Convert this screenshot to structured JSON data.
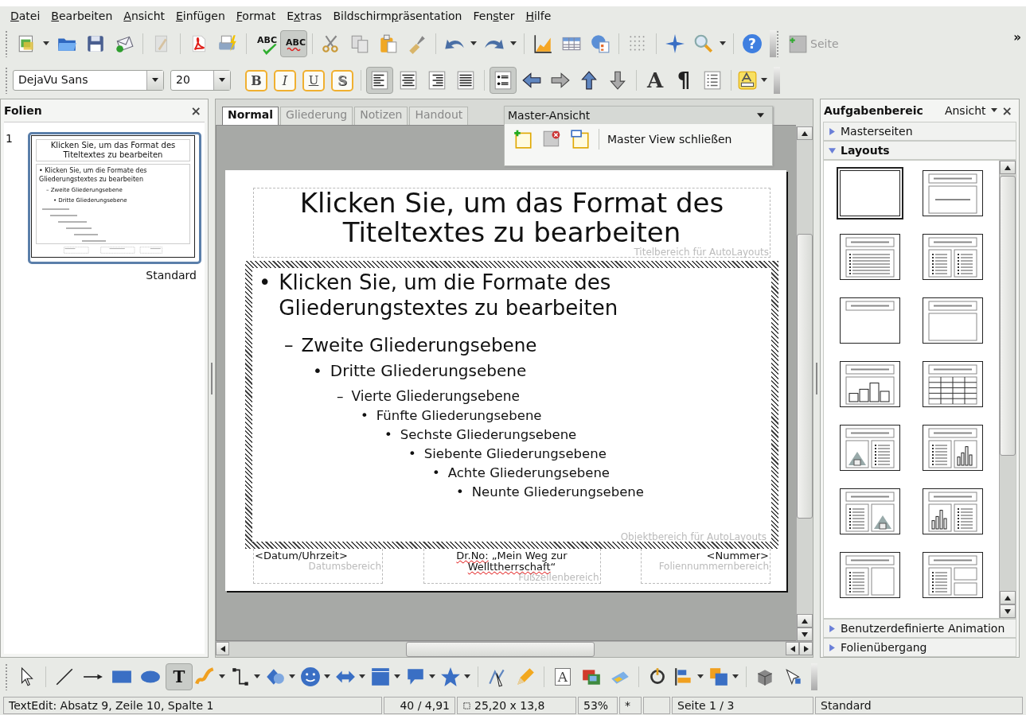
{
  "menu": [
    {
      "key": "D",
      "post": "atei"
    },
    {
      "key": "B",
      "post": "earbeiten"
    },
    {
      "key": "A",
      "post": "nsicht"
    },
    {
      "key": "E",
      "post": "infügen"
    },
    {
      "key": "F",
      "post": "ormat"
    },
    {
      "pre": "E",
      "key": "x",
      "post": "tras"
    },
    {
      "pre": "Bildschirm",
      "key": "p",
      "post": "räsentation"
    },
    {
      "pre": "Fen",
      "key": "s",
      "post": "ter"
    },
    {
      "key": "H",
      "post": "ilfe"
    }
  ],
  "standard_toolbar": {
    "items": [
      {
        "kind": "new",
        "pressed": false,
        "dropdown": true,
        "disabled": false
      },
      {
        "kind": "open",
        "pressed": false,
        "dropdown": false,
        "disabled": false
      },
      {
        "kind": "save",
        "pressed": false,
        "dropdown": false,
        "disabled": false
      },
      {
        "kind": "mail",
        "pressed": false,
        "dropdown": false,
        "disabled": false
      },
      {
        "kind": "separator"
      },
      {
        "kind": "edit",
        "pressed": false,
        "dropdown": false,
        "disabled": true
      },
      {
        "kind": "separator"
      },
      {
        "kind": "pdf",
        "pressed": false,
        "dropdown": false,
        "disabled": false
      },
      {
        "kind": "print",
        "pressed": false,
        "dropdown": false,
        "disabled": false
      },
      {
        "kind": "separator"
      },
      {
        "kind": "spellcheck",
        "label": "ABC",
        "pressed": false,
        "dropdown": false,
        "disabled": false
      },
      {
        "kind": "autospell",
        "label": "ABC",
        "pressed": true,
        "dropdown": false,
        "disabled": false
      },
      {
        "kind": "separator"
      },
      {
        "kind": "cut",
        "pressed": false,
        "dropdown": false,
        "disabled": false
      },
      {
        "kind": "copy",
        "pressed": false,
        "dropdown": false,
        "disabled": false
      },
      {
        "kind": "paste",
        "pressed": false,
        "dropdown": false,
        "disabled": false
      },
      {
        "kind": "brush",
        "pressed": false,
        "dropdown": false,
        "disabled": false
      },
      {
        "kind": "separator"
      },
      {
        "kind": "undo",
        "pressed": false,
        "dropdown": true,
        "disabled": false
      },
      {
        "kind": "redo",
        "pressed": false,
        "dropdown": true,
        "disabled": false
      },
      {
        "kind": "separator"
      },
      {
        "kind": "chart",
        "pressed": false,
        "dropdown": false,
        "disabled": false
      },
      {
        "kind": "table",
        "pressed": false,
        "dropdown": false,
        "disabled": false
      },
      {
        "kind": "globe",
        "pressed": false,
        "dropdown": false,
        "disabled": false
      },
      {
        "kind": "separator"
      },
      {
        "kind": "grid",
        "pressed": false,
        "dropdown": false,
        "disabled": false
      },
      {
        "kind": "separator"
      },
      {
        "kind": "star4",
        "pressed": false,
        "dropdown": false,
        "disabled": false
      },
      {
        "kind": "zoom",
        "pressed": false,
        "dropdown": true,
        "disabled": false
      },
      {
        "kind": "separator"
      },
      {
        "kind": "help",
        "label": "?",
        "pressed": false,
        "dropdown": false,
        "disabled": false
      }
    ],
    "page_button": {
      "label": "Seite",
      "disabled": true
    },
    "overflow": "»"
  },
  "formatting_toolbar": {
    "font": "DejaVu Sans",
    "size": "20",
    "items": [
      {
        "kind": "bold",
        "label": "B",
        "pressed": false,
        "dropdown": false,
        "disabled": false
      },
      {
        "kind": "italic",
        "label": "I",
        "pressed": false,
        "dropdown": false,
        "disabled": false
      },
      {
        "kind": "underline",
        "label": "U",
        "pressed": false,
        "dropdown": false,
        "disabled": false
      },
      {
        "kind": "shadow",
        "label": "S",
        "pressed": false,
        "dropdown": false,
        "disabled": false
      },
      {
        "kind": "separator"
      },
      {
        "kind": "align-left",
        "pressed": true,
        "dropdown": false,
        "disabled": false
      },
      {
        "kind": "align-center",
        "pressed": false,
        "dropdown": false,
        "disabled": false
      },
      {
        "kind": "align-right",
        "pressed": false,
        "dropdown": false,
        "disabled": false
      },
      {
        "kind": "justify",
        "pressed": false,
        "dropdown": false,
        "disabled": false
      },
      {
        "kind": "separator"
      },
      {
        "kind": "bullets",
        "pressed": true,
        "dropdown": false,
        "disabled": false
      },
      {
        "kind": "arrow-left",
        "pressed": false,
        "dropdown": false,
        "disabled": false
      },
      {
        "kind": "arrow-right",
        "pressed": false,
        "dropdown": false,
        "disabled": false
      },
      {
        "kind": "arrow-up",
        "pressed": false,
        "dropdown": false,
        "disabled": false
      },
      {
        "kind": "arrow-down",
        "pressed": false,
        "dropdown": false,
        "disabled": false
      },
      {
        "kind": "separator"
      },
      {
        "kind": "character",
        "label": "A",
        "pressed": false,
        "dropdown": false,
        "disabled": false
      },
      {
        "kind": "paragraph",
        "label": "¶",
        "pressed": false,
        "dropdown": false,
        "disabled": false
      },
      {
        "kind": "list",
        "pressed": false,
        "dropdown": false,
        "disabled": false
      },
      {
        "kind": "separator"
      },
      {
        "kind": "highlight",
        "pressed": false,
        "dropdown": true,
        "disabled": false
      }
    ]
  },
  "slides_panel": {
    "title": "Folien",
    "close": "×",
    "slides": [
      {
        "number": "1",
        "selected": true,
        "layout": "Standard",
        "preview": {
          "title": "Klicken Sie, um das Format des Titeltextes zu bearbeiten",
          "outline": [
            {
              "bullet": "•",
              "text": "Klicken Sie, um die Formate des Gliederungstextes zu bearbeiten",
              "children": [
                {
                  "bullet": "–",
                  "text": "Zweite Gliederungsebene",
                  "children": [
                    {
                      "bullet": "•",
                      "text": "Dritte Gliederungsebene"
                    }
                  ]
                }
              ]
            }
          ]
        }
      }
    ]
  },
  "view_tabs": [
    {
      "label": "Normal",
      "selected": true
    },
    {
      "label": "Gliederung",
      "selected": false
    },
    {
      "label": "Notizen",
      "selected": false
    },
    {
      "label": "Handout",
      "selected": false
    }
  ],
  "master_toolbar": {
    "title": "Master-Ansicht",
    "close_label": "Master View schließen"
  },
  "slide": {
    "title": "Klicken Sie, um das Format des Titeltextes zu bearbeiten",
    "title_area": "Titelbereich für AutoLayouts",
    "outline": [
      {
        "bullet": "•",
        "text": "Klicken Sie, um die Formate des Gliederungstextes zu bearbeiten",
        "children": [
          {
            "bullet": "–",
            "text": "Zweite Gliederungsebene",
            "children": [
              {
                "bullet": "•",
                "text": "Dritte Gliederungsebene",
                "children": [
                  {
                    "bullet": "–",
                    "text": "Vierte Gliederungsebene",
                    "children": [
                      {
                        "bullet": "•",
                        "text": "Fünfte Gliederungsebene",
                        "children": [
                          {
                            "bullet": "•",
                            "text": "Sechste Gliederungsebene",
                            "children": [
                              {
                                "bullet": "•",
                                "text": "Siebente Gliederungsebene",
                                "children": [
                                  {
                                    "bullet": "•",
                                    "text": "Achte Gliederungsebene",
                                    "children": [
                                      {
                                        "bullet": "•",
                                        "text": "Neunte Gliederungsebene"
                                      }
                                    ]
                                  }
                                ]
                              }
                            ]
                          }
                        ]
                      }
                    ]
                  }
                ]
              }
            ]
          }
        ]
      }
    ],
    "outline_area": "Objektbereich für AutoLayouts",
    "footer": [
      {
        "kind": "date",
        "parts": [
          {
            "text": "<Datum/Uhrzeit>",
            "misspelled": false
          }
        ],
        "area": "Datumsbereich"
      },
      {
        "kind": "footer",
        "parts": [
          {
            "text": "Dr.No:",
            "misspelled": true
          },
          {
            "text": " „Mein Weg zur ",
            "misspelled": false
          },
          {
            "text": "Wellttherrschaft",
            "misspelled": true
          },
          {
            "text": "“",
            "misspelled": false
          }
        ],
        "area": "Fußzeilenbereich"
      },
      {
        "kind": "number",
        "parts": [
          {
            "text": "<Nummer>",
            "misspelled": false
          }
        ],
        "area": "Foliennummernbereich"
      }
    ]
  },
  "task_pane": {
    "title": "Aufgabenbereic",
    "view_menu": "Ansicht",
    "close": "×",
    "sections_top": [
      {
        "title": "Masterseiten",
        "expanded": false
      },
      {
        "title": "Layouts",
        "expanded": true
      }
    ],
    "layouts": [
      {
        "kind": "blank",
        "selected": true
      },
      {
        "kind": "title-text",
        "selected": false
      },
      {
        "kind": "bullets",
        "selected": false
      },
      {
        "kind": "two-bullets",
        "selected": false
      },
      {
        "kind": "title-only",
        "selected": false
      },
      {
        "kind": "box",
        "selected": false
      },
      {
        "kind": "chart",
        "selected": false
      },
      {
        "kind": "table",
        "selected": false
      },
      {
        "kind": "picture-bullets",
        "selected": false
      },
      {
        "kind": "bullets-chart",
        "selected": false
      },
      {
        "kind": "bullets-picture",
        "selected": false
      },
      {
        "kind": "chart-bullets",
        "selected": false
      },
      {
        "kind": "bullets-box",
        "selected": false
      },
      {
        "kind": "bullets-two-boxes",
        "selected": false
      }
    ],
    "sections_bottom": [
      {
        "title": "Benutzerdefinierte Animation",
        "expanded": false
      },
      {
        "title": "Folienübergang",
        "expanded": false
      }
    ]
  },
  "drawing_toolbar": {
    "items": [
      {
        "kind": "select",
        "pressed": false,
        "dropdown": false,
        "disabled": false
      },
      {
        "kind": "separator"
      },
      {
        "kind": "line",
        "pressed": false,
        "dropdown": false,
        "disabled": false
      },
      {
        "kind": "line-arrow",
        "pressed": false,
        "dropdown": false,
        "disabled": false
      },
      {
        "kind": "rectangle",
        "pressed": false,
        "dropdown": false,
        "disabled": false
      },
      {
        "kind": "ellipse",
        "pressed": false,
        "dropdown": false,
        "disabled": false
      },
      {
        "kind": "text",
        "label": "T",
        "pressed": true,
        "dropdown": false,
        "disabled": false
      },
      {
        "kind": "curve",
        "pressed": false,
        "dropdown": true,
        "disabled": false
      },
      {
        "kind": "connector",
        "pressed": false,
        "dropdown": true,
        "disabled": false
      },
      {
        "kind": "shapes",
        "pressed": false,
        "dropdown": true,
        "disabled": false
      },
      {
        "kind": "smiley",
        "pressed": false,
        "dropdown": true,
        "disabled": false
      },
      {
        "kind": "double-arrow",
        "pressed": false,
        "dropdown": true,
        "disabled": false
      },
      {
        "kind": "flowchart",
        "pressed": false,
        "dropdown": true,
        "disabled": false
      },
      {
        "kind": "callout",
        "pressed": false,
        "dropdown": true,
        "disabled": false
      },
      {
        "kind": "star",
        "pressed": false,
        "dropdown": true,
        "disabled": false
      },
      {
        "kind": "separator"
      },
      {
        "kind": "points",
        "pressed": false,
        "dropdown": false,
        "disabled": false
      },
      {
        "kind": "pencil",
        "pressed": false,
        "dropdown": false,
        "disabled": false
      },
      {
        "kind": "separator"
      },
      {
        "kind": "fontwork",
        "label": "A",
        "pressed": false,
        "dropdown": false,
        "disabled": false
      },
      {
        "kind": "image",
        "pressed": false,
        "dropdown": false,
        "disabled": false
      },
      {
        "kind": "gallery",
        "pressed": false,
        "dropdown": false,
        "disabled": false
      },
      {
        "kind": "separator"
      },
      {
        "kind": "rotate",
        "pressed": false,
        "dropdown": false,
        "disabled": false
      },
      {
        "kind": "align",
        "pressed": false,
        "dropdown": true,
        "disabled": false
      },
      {
        "kind": "arrange",
        "pressed": false,
        "dropdown": true,
        "disabled": false
      },
      {
        "kind": "separator"
      },
      {
        "kind": "extrusion",
        "pressed": false,
        "dropdown": false,
        "disabled": false
      },
      {
        "kind": "glue",
        "pressed": false,
        "dropdown": false,
        "disabled": false
      }
    ]
  },
  "status_bar": {
    "info": "TextEdit: Absatz 9, Zeile 10, Spalte 1",
    "position": "40 / 4,91",
    "size": "25,20 x 13,8",
    "zoom": "53%",
    "modified": "*",
    "page": "Seite 1 / 3",
    "master": "Standard"
  }
}
